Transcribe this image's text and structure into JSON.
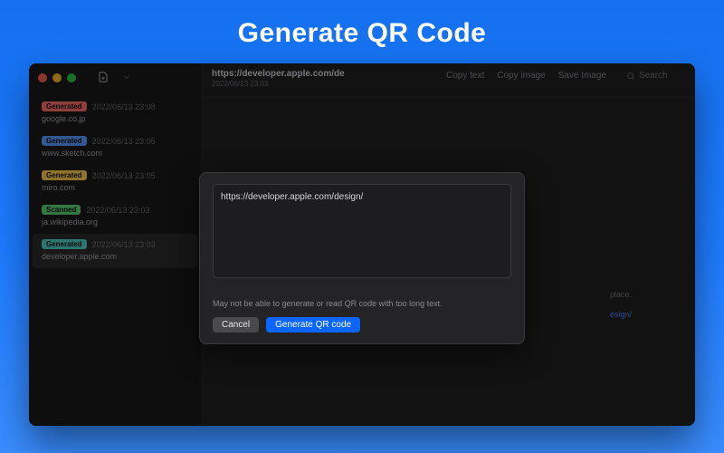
{
  "hero": {
    "title": "Generate QR Code"
  },
  "traffic": {
    "red": "close-icon",
    "yellow": "minimize-icon",
    "green": "zoom-icon"
  },
  "toolbar": {
    "add_icon": "add-document-icon",
    "chevron_icon": "chevron-down-icon"
  },
  "sidebar": {
    "items": [
      {
        "badge": "Generated",
        "badge_color": "b-red",
        "date": "2022/06/13 23:08",
        "subtitle": "google.co.jp"
      },
      {
        "badge": "Generated",
        "badge_color": "b-blue",
        "date": "2022/06/13 23:05",
        "subtitle": "www.sketch.com"
      },
      {
        "badge": "Generated",
        "badge_color": "b-yellow",
        "date": "2022/06/13 23:05",
        "subtitle": "miro.com"
      },
      {
        "badge": "Scanned",
        "badge_color": "b-green",
        "date": "2022/06/13 23:03",
        "subtitle": "ja.wikipedia.org"
      },
      {
        "badge": "Generated",
        "badge_color": "b-teal",
        "date": "2022/06/13 23:03",
        "subtitle": "developer.apple.com"
      }
    ],
    "selected_index": 4
  },
  "header": {
    "title": "https://developer.apple.com/de",
    "subtitle": "2022/06/13 23:03",
    "actions": {
      "copy_text": "Copy text",
      "copy_image": "Copy image",
      "save_image": "Save Image"
    },
    "search_placeholder": "Search"
  },
  "body": {
    "hint_tail": "place.",
    "link_tail": "esign/"
  },
  "modal": {
    "input_value": "https://developer.apple.com/design/",
    "hint": "May not be able to generate or read QR code with too long text.",
    "cancel_label": "Cancel",
    "generate_label": "Generate QR code"
  }
}
